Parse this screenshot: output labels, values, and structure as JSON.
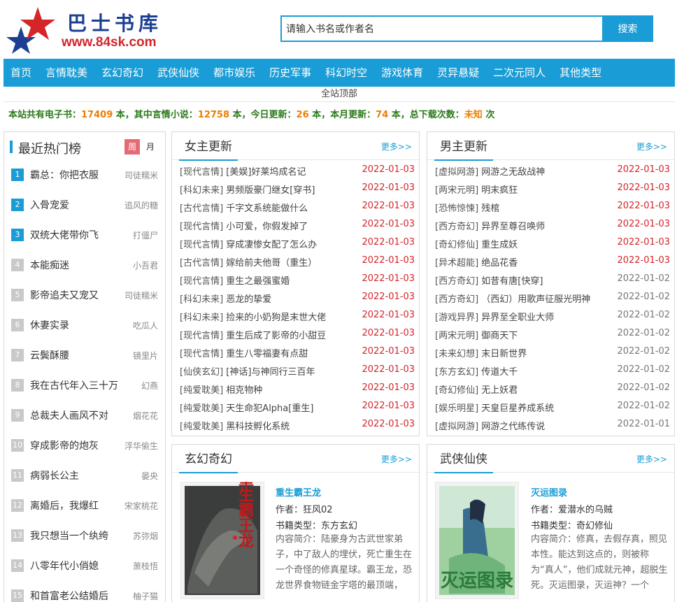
{
  "site": {
    "title": "巴士书库",
    "url": "www.84sk.com"
  },
  "search": {
    "placeholder": "请输入书名或作者名",
    "value": "请输入书名或作者名",
    "button": "搜索"
  },
  "nav": [
    "首页",
    "言情耽美",
    "玄幻奇幻",
    "武侠仙侠",
    "都市娱乐",
    "历史军事",
    "科幻时空",
    "游戏体育",
    "灵异悬疑",
    "二次元同人",
    "其他类型"
  ],
  "sub_nav": "全站顶部",
  "stats": {
    "t1": "本站共有电子书：",
    "total": "17409",
    "t2": " 本，其中言情小说：",
    "romance": "12758",
    "t3": " 本，今日更新：",
    "today": "26",
    "t4": " 本，本月更新：",
    "month": "74",
    "t5": " 本，总下载次数：",
    "downloads": "未知",
    "t6": " 次"
  },
  "hot": {
    "title": "最近热门榜",
    "tab_week": "周",
    "tab_month": "月",
    "items": [
      {
        "rank": "1",
        "name": "霸总：你把衣服",
        "author": "司徒糯米"
      },
      {
        "rank": "2",
        "name": "入骨宠爱",
        "author": "追风的糖"
      },
      {
        "rank": "3",
        "name": "双统大佬带你飞",
        "author": "打僵尸"
      },
      {
        "rank": "4",
        "name": "本能痴迷",
        "author": "小吾君"
      },
      {
        "rank": "5",
        "name": "影帝追夫又宠又",
        "author": "司徒糯米"
      },
      {
        "rank": "6",
        "name": "休妻实录",
        "author": "吃瓜人"
      },
      {
        "rank": "7",
        "name": "云鬓酥腰",
        "author": "镜里片"
      },
      {
        "rank": "8",
        "name": "我在古代年入三十万",
        "author": "幻燕"
      },
      {
        "rank": "9",
        "name": "总裁夫人画风不对",
        "author": "烟花花"
      },
      {
        "rank": "10",
        "name": "穿成影帝的炮灰",
        "author": "浮华偷生"
      },
      {
        "rank": "11",
        "name": "病弱长公主",
        "author": "晏央"
      },
      {
        "rank": "12",
        "name": "离婚后，我爆红",
        "author": "宋家桃花"
      },
      {
        "rank": "13",
        "name": "我只想当一个纨绔",
        "author": "苏弥烟"
      },
      {
        "rank": "14",
        "name": "八零年代小俏媳",
        "author": "萧枝悟"
      },
      {
        "rank": "15",
        "name": "和首富老公结婚后",
        "author": "柚子猫"
      }
    ]
  },
  "female": {
    "title": "女主更新",
    "more": "更多>>",
    "items": [
      {
        "cat": "[现代言情]",
        "title": "[美娱]好莱坞成名记",
        "date": "2022-01-03"
      },
      {
        "cat": "[科幻未来]",
        "title": "男频版豪门继女[穿书]",
        "date": "2022-01-03"
      },
      {
        "cat": "[古代言情]",
        "title": "千字文系统能做什么",
        "date": "2022-01-03"
      },
      {
        "cat": "[现代言情]",
        "title": "小可爱，你假发掉了",
        "date": "2022-01-03"
      },
      {
        "cat": "[现代言情]",
        "title": "穿成凄惨女配了怎么办",
        "date": "2022-01-03"
      },
      {
        "cat": "[古代言情]",
        "title": "嫁给前夫他哥（重生）",
        "date": "2022-01-03"
      },
      {
        "cat": "[现代言情]",
        "title": "重生之最强蜜婚",
        "date": "2022-01-03"
      },
      {
        "cat": "[科幻未来]",
        "title": "恶龙的挚爱",
        "date": "2022-01-03"
      },
      {
        "cat": "[科幻未来]",
        "title": "捡来的小奶狗是末世大佬",
        "date": "2022-01-03"
      },
      {
        "cat": "[现代言情]",
        "title": "重生后成了影帝的小甜豆",
        "date": "2022-01-03"
      },
      {
        "cat": "[现代言情]",
        "title": "重生八零福妻有点甜",
        "date": "2022-01-03"
      },
      {
        "cat": "[仙侠玄幻]",
        "title": "[神话]与神同行三百年",
        "date": "2022-01-03"
      },
      {
        "cat": "[纯爱耽美]",
        "title": "相克物种",
        "date": "2022-01-03"
      },
      {
        "cat": "[纯爱耽美]",
        "title": "天生命犯Alpha[重生]",
        "date": "2022-01-03"
      },
      {
        "cat": "[纯爱耽美]",
        "title": "黑科技孵化系统",
        "date": "2022-01-03"
      }
    ]
  },
  "male": {
    "title": "男主更新",
    "more": "更多>>",
    "items": [
      {
        "cat": "[虚拟网游]",
        "title": "网游之无敌战神",
        "date": "2022-01-03"
      },
      {
        "cat": "[两宋元明]",
        "title": "明末疯狂",
        "date": "2022-01-03"
      },
      {
        "cat": "[恐怖惊悚]",
        "title": "残棺",
        "date": "2022-01-03"
      },
      {
        "cat": "[西方奇幻]",
        "title": "异界至尊召唤师",
        "date": "2022-01-03"
      },
      {
        "cat": "[奇幻修仙]",
        "title": "重生成妖",
        "date": "2022-01-03"
      },
      {
        "cat": "[异术超能]",
        "title": "绝品花香",
        "date": "2022-01-03"
      },
      {
        "cat": "[西方奇幻]",
        "title": "如昔有唐[快穿]",
        "date": "2022-01-02"
      },
      {
        "cat": "[西方奇幻]",
        "title": "（西幻）用歌声征服光明神",
        "date": "2022-01-02"
      },
      {
        "cat": "[游戏异界]",
        "title": "异界至全职业大师",
        "date": "2022-01-02"
      },
      {
        "cat": "[两宋元明]",
        "title": "御商天下",
        "date": "2022-01-02"
      },
      {
        "cat": "[未来幻想]",
        "title": "末日新世界",
        "date": "2022-01-02"
      },
      {
        "cat": "[东方玄幻]",
        "title": "传道大千",
        "date": "2022-01-02"
      },
      {
        "cat": "[奇幻修仙]",
        "title": "无上妖君",
        "date": "2022-01-02"
      },
      {
        "cat": "[娱乐明星]",
        "title": "天皇巨星养成系统",
        "date": "2022-01-02"
      },
      {
        "cat": "[虚拟网游]",
        "title": "网游之代练传说",
        "date": "2022-01-01"
      }
    ]
  },
  "xuanhuan": {
    "title": "玄幻奇幻",
    "more": "更多>>",
    "book": {
      "name": "重生霸王龙",
      "cover_text": "重生霸王龙",
      "author_label": "作者：",
      "author": "狂风02",
      "type_label": "书籍类型：",
      "type": "东方玄幻",
      "intro_label": "内容简介：",
      "intro": "陆豪身为古武世家弟子，中了敌人的埋伏，死亡重生在一个奇怪的修真星球。霸王龙，恐龙世界食物链金字塔的最顶端，"
    }
  },
  "wuxia": {
    "title": "武侠仙侠",
    "more": "更多>>",
    "book": {
      "name": "灭运图录",
      "cover_text": "灭运图录",
      "author_label": "作者：",
      "author": "爱潜水的乌贼",
      "type_label": "书籍类型：",
      "type": "奇幻修仙",
      "intro_label": "内容简介：",
      "intro": "修真，去假存真，照见本性。能达到这点的，则被称为“真人”，他们成就元神，超脱生死。灭运图录，灭运神？一个"
    }
  },
  "colors": {
    "accent": "#1a9dd6",
    "date_recent": "#d4252b",
    "date_old": "#777777",
    "stats_green": "#2b7a19",
    "stats_orange": "#f07c00",
    "rank_top": "#1a9dd6",
    "rank_other": "#c9c9c9",
    "tab_active": "#e46b74"
  }
}
